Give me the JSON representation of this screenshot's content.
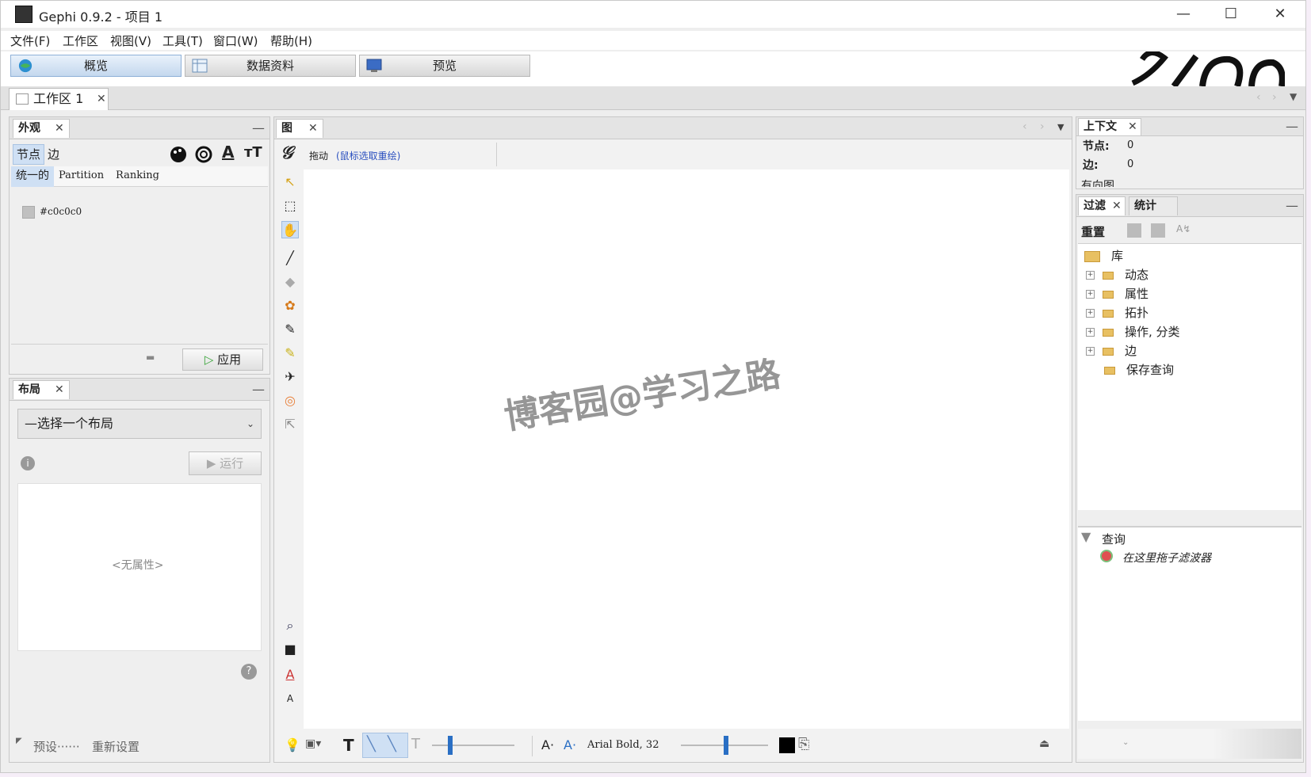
{
  "window": {
    "title": "Gephi 0.9.2 - 项目 1",
    "min": "—",
    "max": "☐",
    "close": "✕"
  },
  "menu": [
    "文件(F)",
    "工作区",
    "视图(V)",
    "工具(T)",
    "窗口(W)",
    "帮助(H)"
  ],
  "modes": {
    "overview": "概览",
    "data": "数据资料",
    "preview": "预览"
  },
  "workspace_tab": "工作区 1",
  "appearance": {
    "tab": "外观",
    "sub_tabs": [
      "节点",
      "边"
    ],
    "modes": [
      "统一的",
      "Partition",
      "Ranking"
    ],
    "color_value": "#c0c0c0",
    "apply": "应用"
  },
  "layout_panel": {
    "tab": "布局",
    "select": "—选择一个布局",
    "run": "运行",
    "empty": "<无属性>",
    "presets": "预设······",
    "reset": "重新设置"
  },
  "graph": {
    "tab": "图",
    "mode_label": "拖动",
    "mode_hint": "(鼠标选取重绘)",
    "font_label": "Arial Bold, 32"
  },
  "context": {
    "tab": "上下文",
    "nodes_label": "节点:",
    "nodes": "0",
    "edges_label": "边:",
    "edges": "0",
    "more": "有向图"
  },
  "filters": {
    "tabs": [
      "过滤",
      "统计"
    ],
    "reset": "重置",
    "library": "库",
    "items": [
      "动态",
      "属性",
      "拓扑",
      "操作, 分类",
      "边",
      "保存查询"
    ],
    "query": "查询",
    "drop_hint": "在这里拖子滤波器"
  },
  "watermark": "博客园@学习之路",
  "colors": {
    "selected_tab": "#cfe0f4",
    "link": "#2a4fbf",
    "canvas": "#ffffff",
    "chrome": "#eeeeee"
  }
}
